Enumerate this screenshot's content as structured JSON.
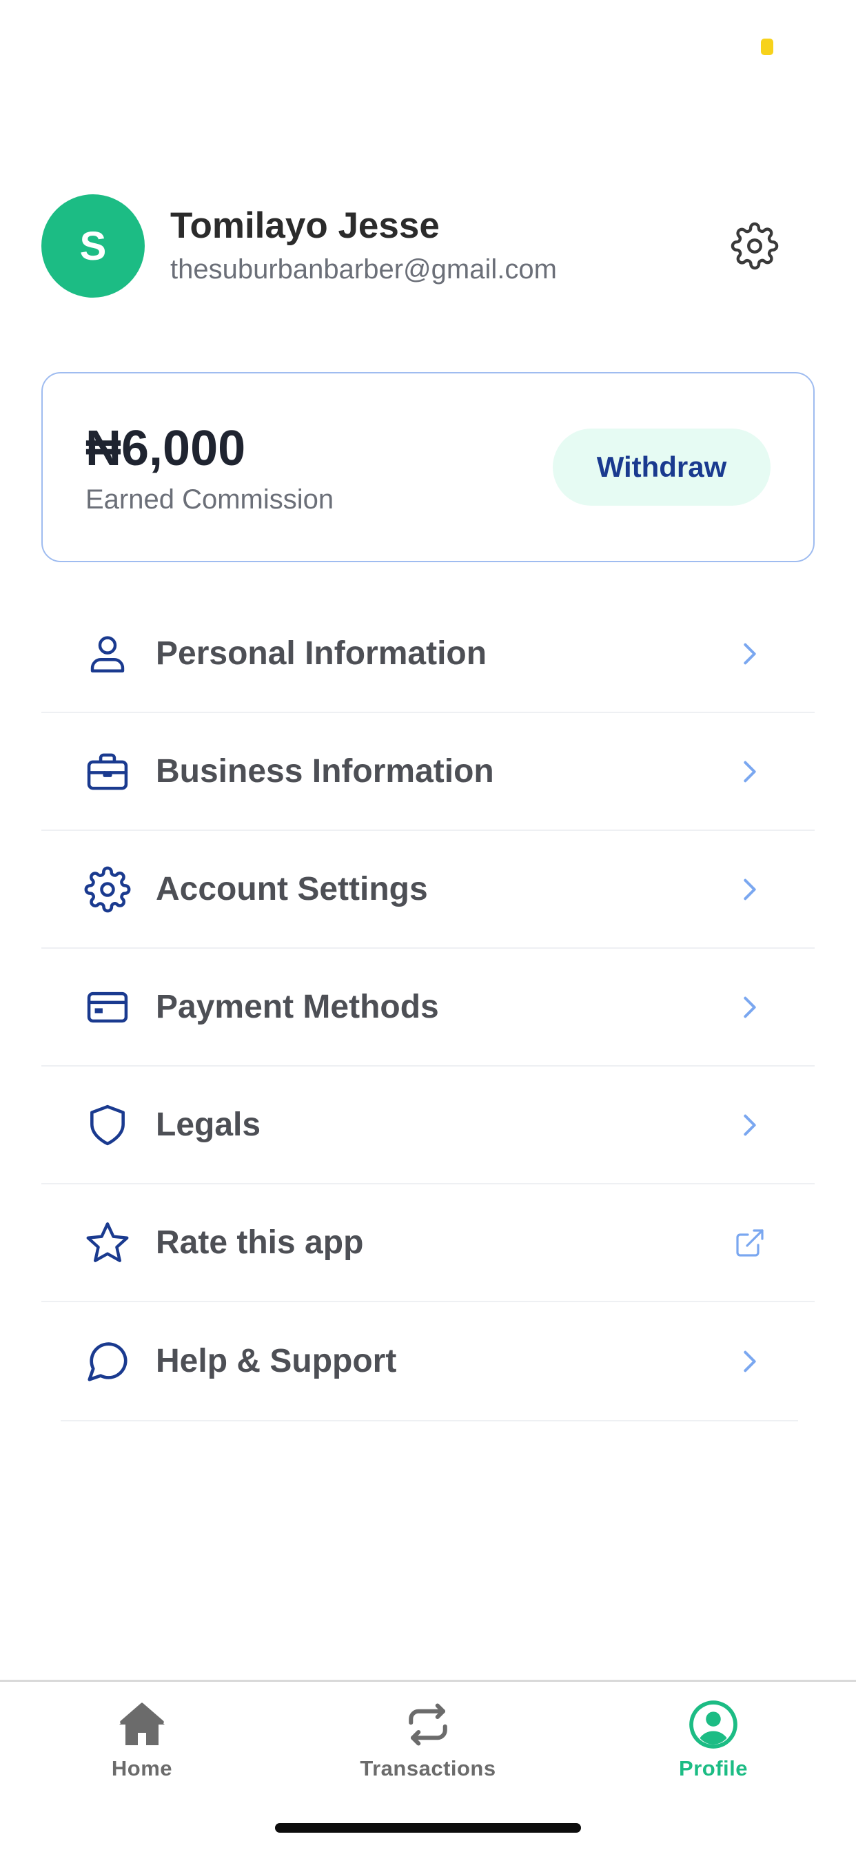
{
  "status_bar": {
    "indicator_color": "#f7d21b"
  },
  "profile": {
    "avatar_initial": "S",
    "name": "Tomilayo Jesse",
    "email": "thesuburbanbarber@gmail.com",
    "settings_icon": "gear-icon"
  },
  "commission": {
    "amount": "₦6,000",
    "label": "Earned Commission",
    "withdraw_label": "Withdraw"
  },
  "menu": {
    "items": [
      {
        "label": "Personal Information",
        "icon": "user-icon",
        "trailing": "chevron-right-icon"
      },
      {
        "label": "Business Information",
        "icon": "briefcase-icon",
        "trailing": "chevron-right-icon"
      },
      {
        "label": "Account Settings",
        "icon": "gear-icon",
        "trailing": "chevron-right-icon"
      },
      {
        "label": "Payment Methods",
        "icon": "card-icon",
        "trailing": "chevron-right-icon"
      },
      {
        "label": "Legals",
        "icon": "shield-icon",
        "trailing": "chevron-right-icon"
      },
      {
        "label": "Rate this app",
        "icon": "star-icon",
        "trailing": "external-link-icon"
      },
      {
        "label": "Help & Support",
        "icon": "chat-bubble-icon",
        "trailing": "chevron-right-icon"
      }
    ]
  },
  "tabbar": {
    "tabs": [
      {
        "label": "Home",
        "icon": "home-icon",
        "active": false
      },
      {
        "label": "Transactions",
        "icon": "transfer-icon",
        "active": false
      },
      {
        "label": "Profile",
        "icon": "profile-icon",
        "active": true
      }
    ]
  },
  "colors": {
    "brand_green": "#1cbc84",
    "navy": "#1a3a8f",
    "accent_blue": "#7aa7f0",
    "card_border": "#9fbcf0"
  }
}
